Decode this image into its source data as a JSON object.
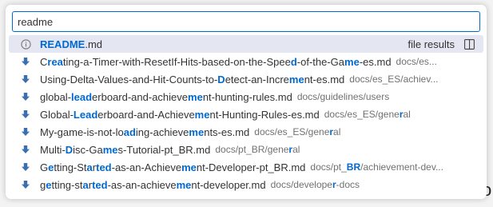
{
  "search": {
    "value": "readme"
  },
  "group": {
    "label": "file results"
  },
  "colors": {
    "accent": "#0069d1",
    "selected_bg": "#e4e6f1",
    "icon_blue": "#3a6fb0",
    "info_gray": "#7a7a7a"
  },
  "items": [
    {
      "icon": "info-icon",
      "segments": [
        {
          "t": "README",
          "h": true
        },
        {
          "t": ".md",
          "h": false
        }
      ],
      "desc_segments": []
    },
    {
      "icon": "markdown-download-icon",
      "segments": [
        {
          "t": "C",
          "h": false
        },
        {
          "t": "rea",
          "h": true
        },
        {
          "t": "ting-a-Timer-with-ResetIf-Hits-based-on-the-Spee",
          "h": false
        },
        {
          "t": "d",
          "h": true
        },
        {
          "t": "-of-the-Ga",
          "h": false
        },
        {
          "t": "me",
          "h": true
        },
        {
          "t": "-es.md",
          "h": false
        }
      ],
      "desc_segments": [
        {
          "t": "docs/es...",
          "h": false
        }
      ]
    },
    {
      "icon": "markdown-download-icon",
      "segments": [
        {
          "t": "Using-Delta-Values-and-Hit-Counts-to-",
          "h": false
        },
        {
          "t": "D",
          "h": true
        },
        {
          "t": "etect-an-Incre",
          "h": false
        },
        {
          "t": "me",
          "h": true
        },
        {
          "t": "nt-es.md",
          "h": false
        }
      ],
      "desc_segments": [
        {
          "t": "docs/es_ES/achiev...",
          "h": false
        }
      ]
    },
    {
      "icon": "markdown-download-icon",
      "segments": [
        {
          "t": "global-",
          "h": false
        },
        {
          "t": "lead",
          "h": true
        },
        {
          "t": "erboard-and-achieve",
          "h": false
        },
        {
          "t": "me",
          "h": true
        },
        {
          "t": "nt-hunting-rules.md",
          "h": false
        }
      ],
      "desc_segments": [
        {
          "t": "docs/guidelines/users",
          "h": false
        }
      ]
    },
    {
      "icon": "markdown-download-icon",
      "segments": [
        {
          "t": "Global-",
          "h": false
        },
        {
          "t": "Lead",
          "h": true
        },
        {
          "t": "erboard-and-Achieve",
          "h": false
        },
        {
          "t": "me",
          "h": true
        },
        {
          "t": "nt-Hunting-Rules-es.md",
          "h": false
        }
      ],
      "desc_segments": [
        {
          "t": "docs/es_ES/gene",
          "h": false
        },
        {
          "t": "r",
          "h": true
        },
        {
          "t": "al",
          "h": false
        }
      ]
    },
    {
      "icon": "markdown-download-icon",
      "segments": [
        {
          "t": "My-game-is-not-lo",
          "h": false
        },
        {
          "t": "ad",
          "h": true
        },
        {
          "t": "ing-achieve",
          "h": false
        },
        {
          "t": "me",
          "h": true
        },
        {
          "t": "nts-es.md",
          "h": false
        }
      ],
      "desc_segments": [
        {
          "t": "docs/es_ES/gene",
          "h": false
        },
        {
          "t": "r",
          "h": true
        },
        {
          "t": "al",
          "h": false
        }
      ]
    },
    {
      "icon": "markdown-download-icon",
      "segments": [
        {
          "t": "Multi-",
          "h": false
        },
        {
          "t": "D",
          "h": true
        },
        {
          "t": "isc-Ga",
          "h": false
        },
        {
          "t": "me",
          "h": true
        },
        {
          "t": "s-Tutorial-pt_BR.md",
          "h": false
        }
      ],
      "desc_segments": [
        {
          "t": "docs/pt_BR/gene",
          "h": false
        },
        {
          "t": "r",
          "h": true
        },
        {
          "t": "al",
          "h": false
        }
      ]
    },
    {
      "icon": "markdown-download-icon",
      "segments": [
        {
          "t": "G",
          "h": false
        },
        {
          "t": "e",
          "h": true
        },
        {
          "t": "tting-St",
          "h": false
        },
        {
          "t": "a",
          "h": true
        },
        {
          "t": "r",
          "h": false
        },
        {
          "t": "ted",
          "h": true
        },
        {
          "t": "-as-an-Achieve",
          "h": false
        },
        {
          "t": "me",
          "h": true
        },
        {
          "t": "nt-Developer-pt_BR.md",
          "h": false
        }
      ],
      "desc_segments": [
        {
          "t": "docs/pt_",
          "h": false
        },
        {
          "t": "BR",
          "h": true
        },
        {
          "t": "/achievement-dev...",
          "h": false
        }
      ]
    },
    {
      "icon": "markdown-download-icon",
      "segments": [
        {
          "t": "g",
          "h": false
        },
        {
          "t": "e",
          "h": true
        },
        {
          "t": "tting-st",
          "h": false
        },
        {
          "t": "a",
          "h": true
        },
        {
          "t": "r",
          "h": false
        },
        {
          "t": "ted",
          "h": true
        },
        {
          "t": "-as-an-achieve",
          "h": false
        },
        {
          "t": "me",
          "h": true
        },
        {
          "t": "nt-developer.md",
          "h": false
        }
      ],
      "desc_segments": [
        {
          "t": "docs/develope",
          "h": false
        },
        {
          "t": "r",
          "h": true
        },
        {
          "t": "-docs",
          "h": false
        }
      ]
    }
  ]
}
